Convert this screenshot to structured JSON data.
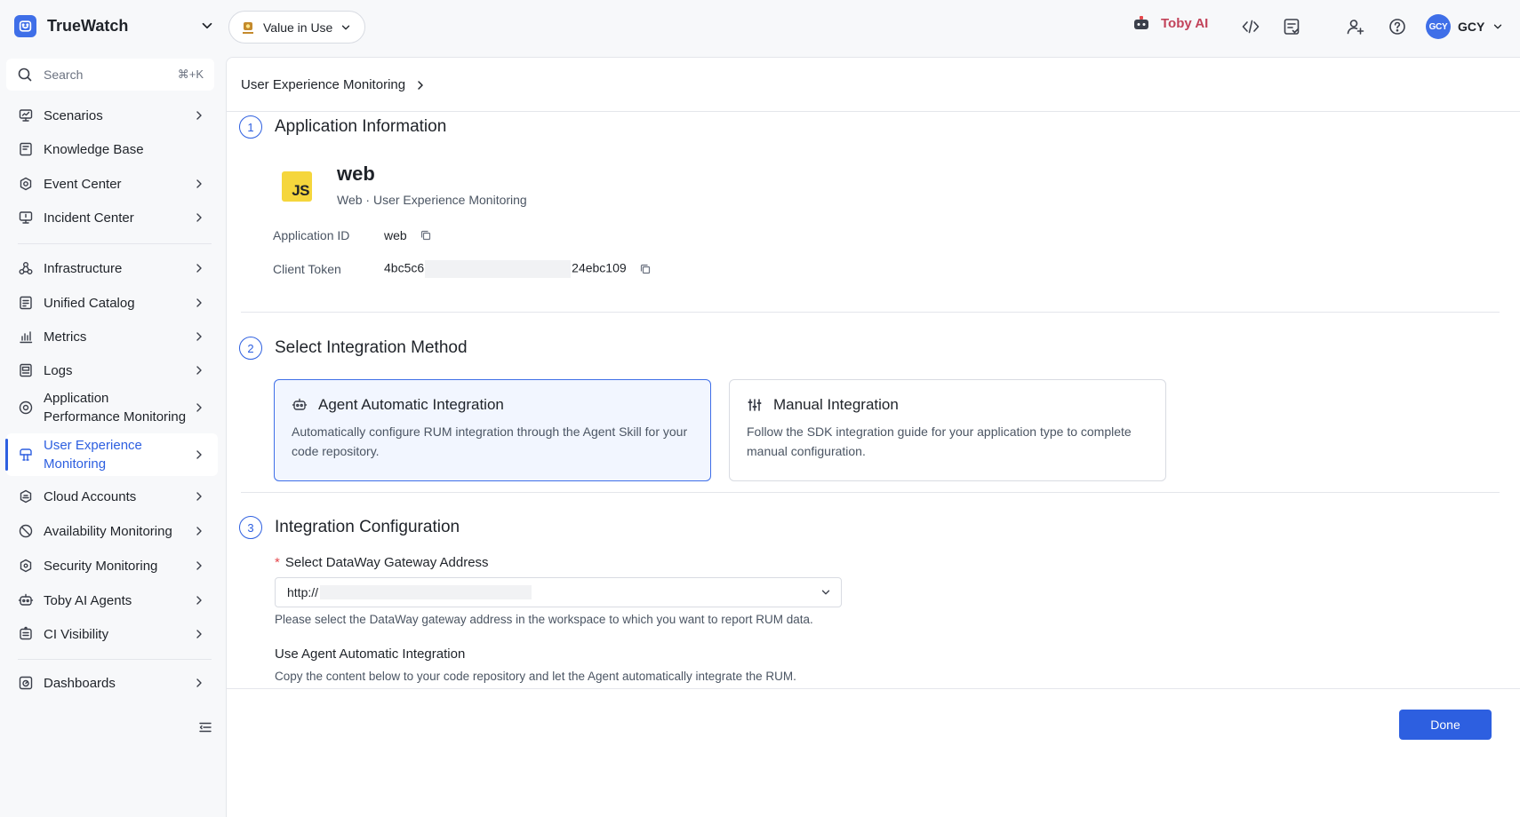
{
  "app": {
    "name": "TrueWatch",
    "value_pill": "Value in Use",
    "toby_ai": "Toby AI",
    "user_initials": "GCY",
    "user_name": "GCY"
  },
  "search": {
    "placeholder": "Search",
    "shortcut": "⌘+K"
  },
  "sidebar": {
    "items": [
      {
        "label": "Scenarios",
        "icon": "monitor-icon",
        "has_children": true
      },
      {
        "label": "Knowledge Base",
        "icon": "book-icon",
        "has_children": false
      },
      {
        "label": "Event Center",
        "icon": "bell-icon",
        "has_children": true
      },
      {
        "label": "Incident Center",
        "icon": "alert-monitor-icon",
        "has_children": true
      },
      {
        "label": "Infrastructure",
        "icon": "nodes-icon",
        "has_children": true
      },
      {
        "label": "Unified Catalog",
        "icon": "catalog-icon",
        "has_children": true
      },
      {
        "label": "Metrics",
        "icon": "bar-chart-icon",
        "has_children": true
      },
      {
        "label": "Logs",
        "icon": "log-icon",
        "has_children": true
      },
      {
        "label_line1": "Application",
        "label_line2": "Performance Monitoring",
        "icon": "apm-icon",
        "has_children": true
      },
      {
        "label_line1": "User Experience",
        "label_line2": "Monitoring",
        "icon": "rum-icon",
        "has_children": true,
        "active": true
      },
      {
        "label": "Cloud Accounts",
        "icon": "cloud-icon",
        "has_children": true
      },
      {
        "label": "Availability Monitoring",
        "icon": "availability-icon",
        "has_children": true
      },
      {
        "label": "Security Monitoring",
        "icon": "shield-icon",
        "has_children": true
      },
      {
        "label": "Toby AI Agents",
        "icon": "robot-icon",
        "has_children": true
      },
      {
        "label": "CI Visibility",
        "icon": "ci-icon",
        "has_children": true
      },
      {
        "label": "Dashboards",
        "icon": "dashboard-icon",
        "has_children": true
      }
    ]
  },
  "breadcrumb": {
    "label": "User Experience Monitoring"
  },
  "steps": [
    {
      "num": "1",
      "title": "Application Information"
    },
    {
      "num": "2",
      "title": "Select Integration Method"
    },
    {
      "num": "3",
      "title": "Integration Configuration"
    }
  ],
  "application": {
    "logo_text": "JS",
    "name": "web",
    "subtitle": "Web · User Experience Monitoring",
    "id_label": "Application ID",
    "id_value": "web",
    "token_label": "Client Token",
    "token_prefix": "4bc5c6",
    "token_suffix": "24ebc109"
  },
  "methods": [
    {
      "title": "Agent Automatic Integration",
      "description": "Automatically configure RUM integration through the Agent Skill for your code repository.",
      "selected": true
    },
    {
      "title": "Manual Integration",
      "description": "Follow the SDK integration guide for your application type to complete manual configuration.",
      "selected": false
    }
  ],
  "config": {
    "required_mark": "*",
    "gateway_label": "Select DataWay Gateway Address",
    "gateway_value_prefix": "http://",
    "gateway_help": "Please select the DataWay gateway address in the workspace to which you want to report RUM data.",
    "agent_title": "Use Agent Automatic Integration",
    "agent_desc": "Copy the content below to your code repository and let the Agent automatically integrate the RUM."
  },
  "footer": {
    "done_label": "Done"
  },
  "colors": {
    "accent": "#2d5fe0",
    "brand_logo": "#3f6fe8",
    "toby": "#c2435a",
    "js_yellow": "#f5d63c",
    "required": "#e5484d"
  }
}
